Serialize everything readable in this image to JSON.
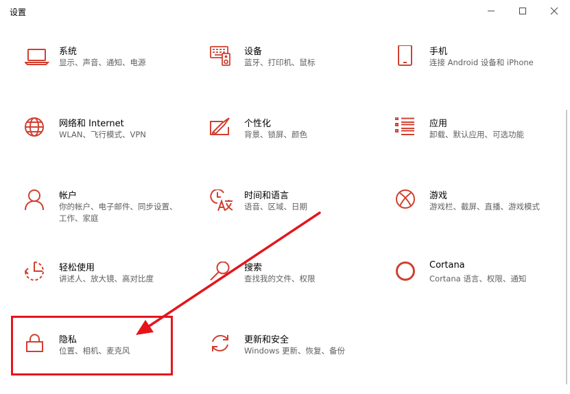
{
  "window": {
    "title": "设置",
    "controls": [
      "minimize-icon",
      "maximize-icon",
      "close-icon"
    ]
  },
  "accent_color": "#d03f2f",
  "annotation_color": "#e5141c",
  "tiles": [
    {
      "name": "系统",
      "desc": "显示、声音、通知、电源",
      "icon": "laptop-icon"
    },
    {
      "name": "设备",
      "desc": "蓝牙、打印机、鼠标",
      "icon": "keyboard-icon"
    },
    {
      "name": "手机",
      "desc": "连接 Android 设备和 iPhone",
      "icon": "phone-icon"
    },
    {
      "name": "网络和 Internet",
      "desc": "WLAN、飞行模式、VPN",
      "icon": "globe-icon"
    },
    {
      "name": "个性化",
      "desc": "背景、锁屏、颜色",
      "icon": "paint-icon"
    },
    {
      "name": "应用",
      "desc": "卸载、默认应用、可选功能",
      "icon": "apps-list-icon"
    },
    {
      "name": "帐户",
      "desc": "你的帐户、电子邮件、同步设置、工作、家庭",
      "icon": "person-icon"
    },
    {
      "name": "时间和语言",
      "desc": "语音、区域、日期",
      "icon": "time-language-icon"
    },
    {
      "name": "游戏",
      "desc": "游戏栏、截屏、直播、游戏模式",
      "icon": "xbox-icon"
    },
    {
      "name": "轻松使用",
      "desc": "讲述人、放大镜、高对比度",
      "icon": "ease-of-access-icon"
    },
    {
      "name": "搜索",
      "desc": "查找我的文件、权限",
      "icon": "search-icon"
    },
    {
      "name": "Cortana",
      "desc": "Cortana 语言、权限、通知",
      "icon": "cortana-icon"
    },
    {
      "name": "隐私",
      "desc": "位置、相机、麦克风",
      "icon": "lock-icon"
    },
    {
      "name": "更新和安全",
      "desc": "Windows 更新、恢复、备份",
      "icon": "sync-icon"
    }
  ]
}
